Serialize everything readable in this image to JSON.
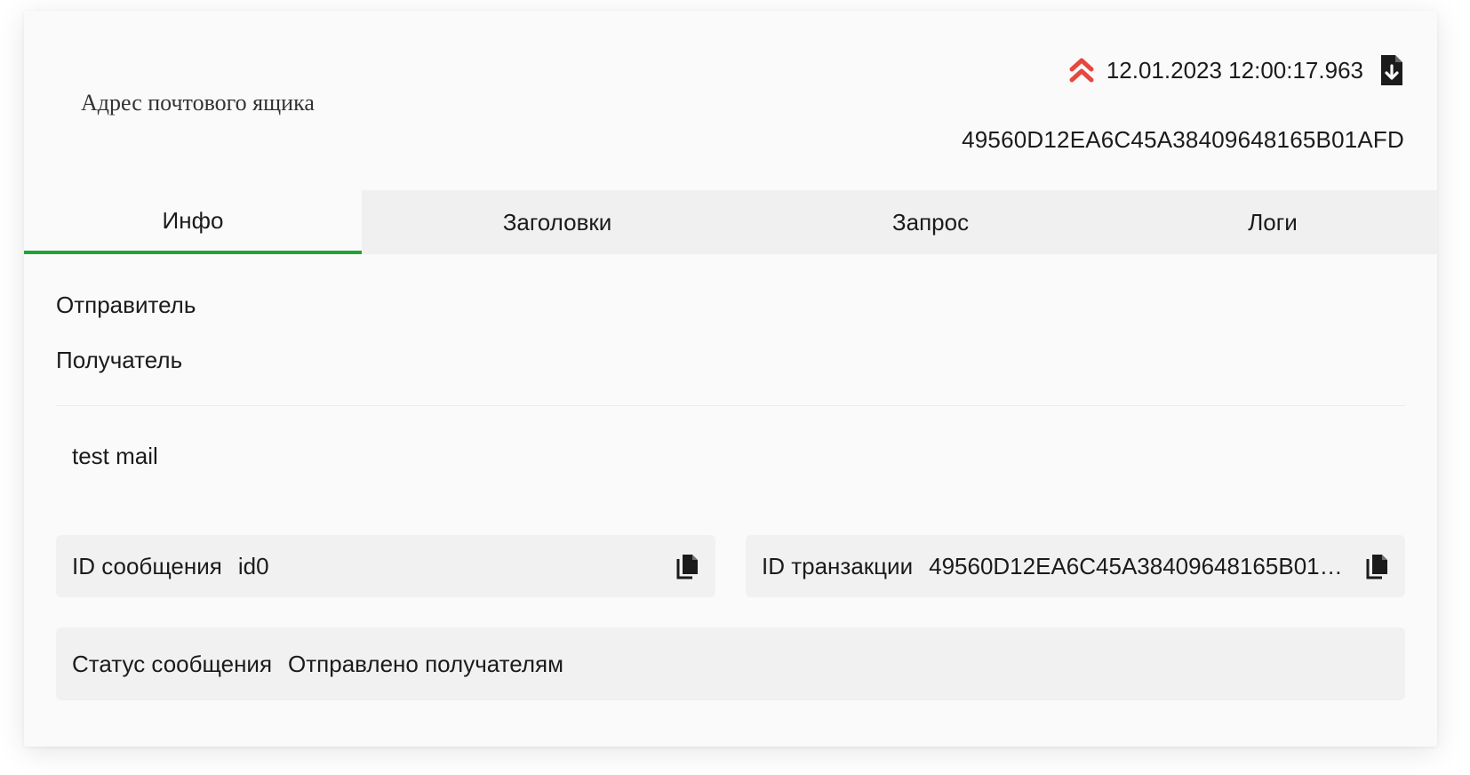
{
  "header": {
    "mailbox_address_label": "Адрес почтового ящика",
    "datetime": "12.01.2023 12:00:17.963",
    "transaction_id": "49560D12EA6C45A38409648165B01AFD",
    "priority_icon": "double-chevron-up-icon",
    "download_icon": "file-download-icon",
    "priority_color": "#e5483f"
  },
  "tabs": [
    {
      "label": "Инфо",
      "active": true
    },
    {
      "label": "Заголовки",
      "active": false
    },
    {
      "label": "Запрос",
      "active": false
    },
    {
      "label": "Логи",
      "active": false
    }
  ],
  "info": {
    "sender_label": "Отправитель",
    "recipient_label": "Получатель",
    "message_body": "test mail",
    "message_id": {
      "label": "ID сообщения",
      "value": "id0",
      "icon": "copy-icon"
    },
    "transaction_id": {
      "label": "ID транзакции",
      "value": "49560D12EA6C45A38409648165B01AFD",
      "icon": "copy-icon"
    },
    "status": {
      "label": "Статус сообщения",
      "value": "Отправлено получателям"
    }
  },
  "colors": {
    "active_tab_underline": "#22a234",
    "tab_bar_background": "#f0f0f0",
    "card_background": "#fafafa",
    "info_box_background": "#f1f1f1"
  }
}
